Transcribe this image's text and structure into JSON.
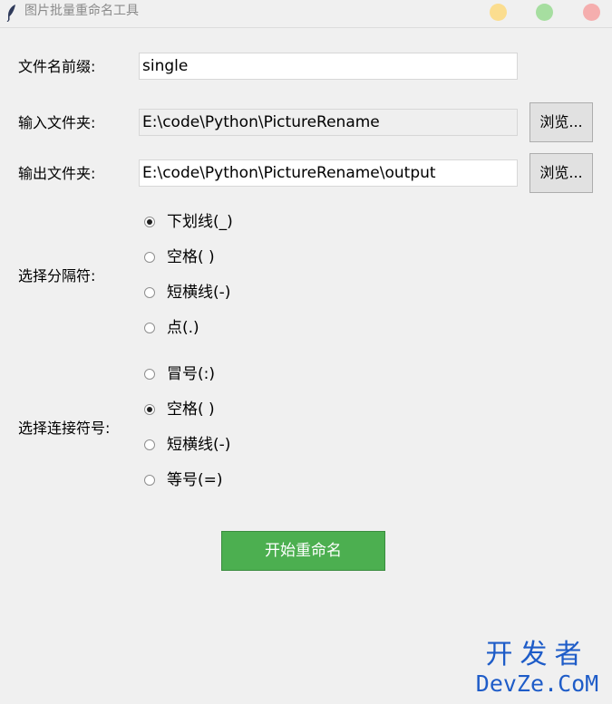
{
  "window": {
    "title": "图片批量重命名工具",
    "app_icon": "feather-icon",
    "controls": {
      "minimize_color": "#fbdd8f",
      "maximize_color": "#a6dea0",
      "close_color": "#f5aeae"
    }
  },
  "form": {
    "prefix": {
      "label": "文件名前缀:",
      "value": "single"
    },
    "input_folder": {
      "label": "输入文件夹:",
      "value": "E:\\code\\Python\\PictureRename",
      "browse_label": "浏览..."
    },
    "output_folder": {
      "label": "输出文件夹:",
      "value": "E:\\code\\Python\\PictureRename\\output",
      "browse_label": "浏览..."
    },
    "separator": {
      "label": "选择分隔符:",
      "options": [
        {
          "label": "下划线(_)",
          "checked": true
        },
        {
          "label": "空格( )",
          "checked": false
        },
        {
          "label": "短横线(-)",
          "checked": false
        },
        {
          "label": "点(.)",
          "checked": false
        }
      ]
    },
    "connector": {
      "label": "选择连接符号:",
      "options": [
        {
          "label": "冒号(:)",
          "checked": false
        },
        {
          "label": "空格( )",
          "checked": true
        },
        {
          "label": "短横线(-)",
          "checked": false
        },
        {
          "label": "等号(=)",
          "checked": false
        }
      ]
    },
    "start_label": "开始重命名",
    "accent_color": "#4caf50"
  },
  "watermark": {
    "top": "开发者",
    "bottom": "DevZe.CoM",
    "color": "#1e5cc8"
  }
}
